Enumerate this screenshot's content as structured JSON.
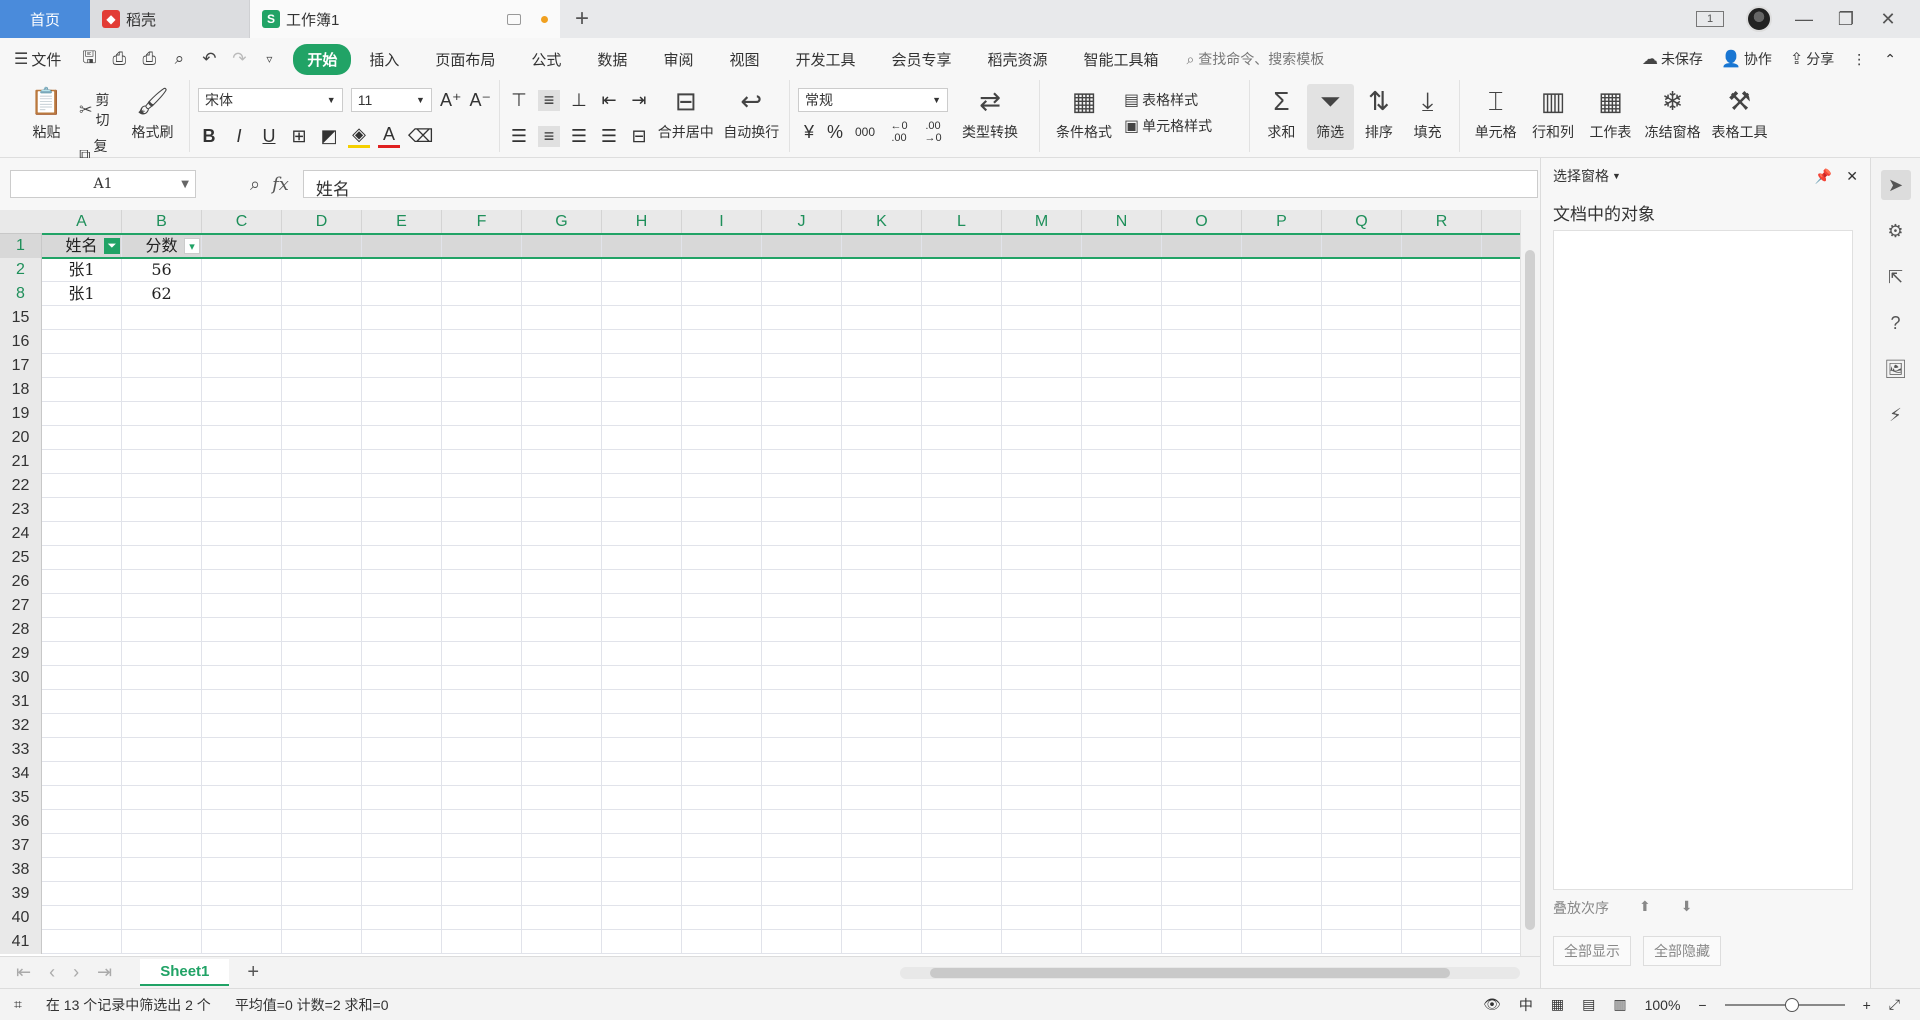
{
  "tabs": {
    "home": "首页",
    "daoke": "稻壳",
    "workbook": "工作簿1",
    "workbook_logo": "S",
    "new_tab": "+"
  },
  "window": {
    "page_indicator": "1"
  },
  "menu": {
    "file": "文件",
    "items": [
      "开始",
      "插入",
      "页面布局",
      "公式",
      "数据",
      "审阅",
      "视图",
      "开发工具",
      "会员专享",
      "稻壳资源",
      "智能工具箱"
    ],
    "search": "查找命令、搜索模板",
    "unsaved": "未保存",
    "collab": "协作",
    "share": "分享"
  },
  "ribbon": {
    "paste": "粘贴",
    "cut": "剪切",
    "copy": "复制",
    "format_painter": "格式刷",
    "font_name": "宋体",
    "font_size": "11",
    "merge_center": "合并居中",
    "wrap_text": "自动换行",
    "number_format": "常规",
    "type_convert": "类型转换",
    "conditional_format": "条件格式",
    "table_style": "表格样式",
    "cell_style": "单元格样式",
    "sum": "求和",
    "filter": "筛选",
    "sort": "排序",
    "fill": "填充",
    "cell": "单元格",
    "row_col": "行和列",
    "worksheet": "工作表",
    "freeze": "冻结窗格",
    "table_tools": "表格工具",
    "currency": "¥",
    "percent": "%",
    "thousands": "000",
    "dec_inc": "←0 .00",
    "dec_dec": ".00 →0"
  },
  "formula_bar": {
    "name_box": "A1",
    "fx": "fx",
    "content": "姓名"
  },
  "grid": {
    "columns": [
      "A",
      "B",
      "C",
      "D",
      "E",
      "F",
      "G",
      "H",
      "I",
      "J",
      "K",
      "L",
      "M",
      "N",
      "O",
      "P",
      "Q",
      "R"
    ],
    "row_numbers": [
      "1",
      "2",
      "8",
      "15",
      "16",
      "17",
      "18",
      "19",
      "20",
      "21",
      "22",
      "23",
      "24",
      "25",
      "26",
      "27",
      "28",
      "29",
      "30",
      "31",
      "32",
      "33",
      "34",
      "35",
      "36",
      "37",
      "38",
      "39",
      "40",
      "41"
    ],
    "header": [
      "姓名",
      "分数"
    ],
    "data": [
      [
        "张1",
        "56"
      ],
      [
        "张1",
        "62"
      ]
    ]
  },
  "sheets": {
    "tabs": [
      "Sheet1"
    ],
    "add": "+"
  },
  "pane": {
    "title": "选择窗格",
    "subtitle": "文档中的对象",
    "order_label": "叠放次序",
    "show_all": "全部显示",
    "hide_all": "全部隐藏"
  },
  "status": {
    "filter_info": "在 13 个记录中筛选出 2 个",
    "stats": "平均值=0  计数=2  求和=0",
    "zoom": "100%"
  },
  "colors": {
    "accent": "#21a366",
    "home_tab": "#4a8bdb"
  }
}
